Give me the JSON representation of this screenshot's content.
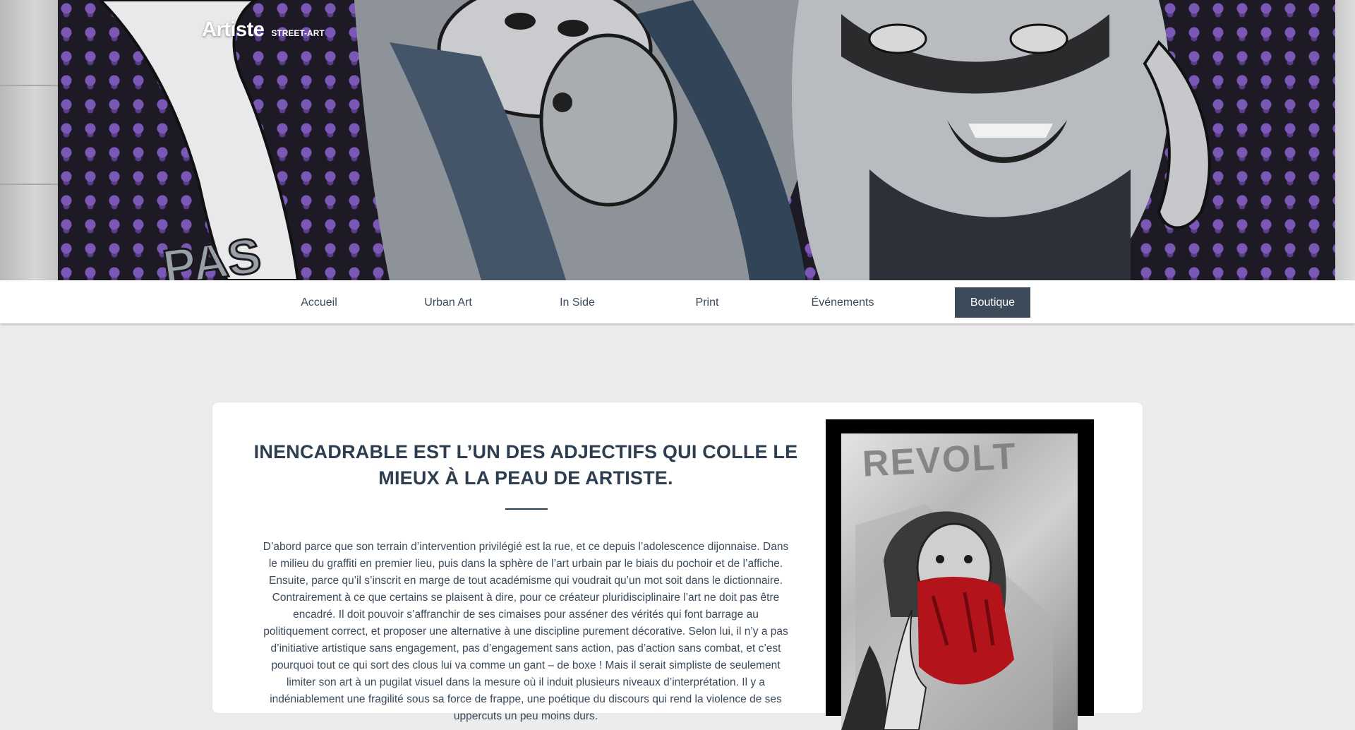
{
  "brand": {
    "name": "Artiste",
    "tagline": "STREET-ART"
  },
  "nav": {
    "items": [
      {
        "label": "Accueil"
      },
      {
        "label": "Urban Art"
      },
      {
        "label": "In Side"
      },
      {
        "label": "Print"
      },
      {
        "label": "Événements"
      },
      {
        "label": "Boutique",
        "active": true
      }
    ]
  },
  "article": {
    "heading": "Inencadrable est l’un des adjectifs qui colle le mieux à la peau de Artiste.",
    "body": "D’abord parce que son terrain d’intervention privilégié est la rue, et ce depuis l’adolescence dijonnaise. Dans le milieu du graffiti en premier lieu, puis dans la sphère de l’art urbain par le biais du pochoir et de l’affiche. Ensuite, parce qu’il s’inscrit en marge de tout académisme qui voudrait qu’un mot soit dans le dictionnaire. Contrairement à ce que certains se plaisent à dire, pour ce créateur pluridisciplinaire l’art ne doit pas être encadré. Il doit pouvoir s’affranchir de ses cimaises pour asséner des vérités qui font barrage au politiquement correct, et proposer une alternative à une discipline purement décorative. Selon lui, il n’y a pas d’initiative artistique sans engagement, pas d’engagement sans action, pas d’action sans combat, et c’est pourquoi tout ce qui sort des clous lui va comme un gant – de boxe ! Mais il serait simpliste de seulement limiter son art à un pugilat visuel dans la mesure où il induit plusieurs niveaux d’interprétation. Il y a indéniablement une fragilité sous sa force de frappe, une poétique du discours qui rend la violence de ses uppercuts un peu moins durs.",
    "artwork_word": "REVOLT"
  },
  "colors": {
    "nav_active_bg": "#3c4a5a",
    "heading": "#2d3e50",
    "page_bg": "#ececec",
    "mural_skulls": "#7b57b6"
  }
}
